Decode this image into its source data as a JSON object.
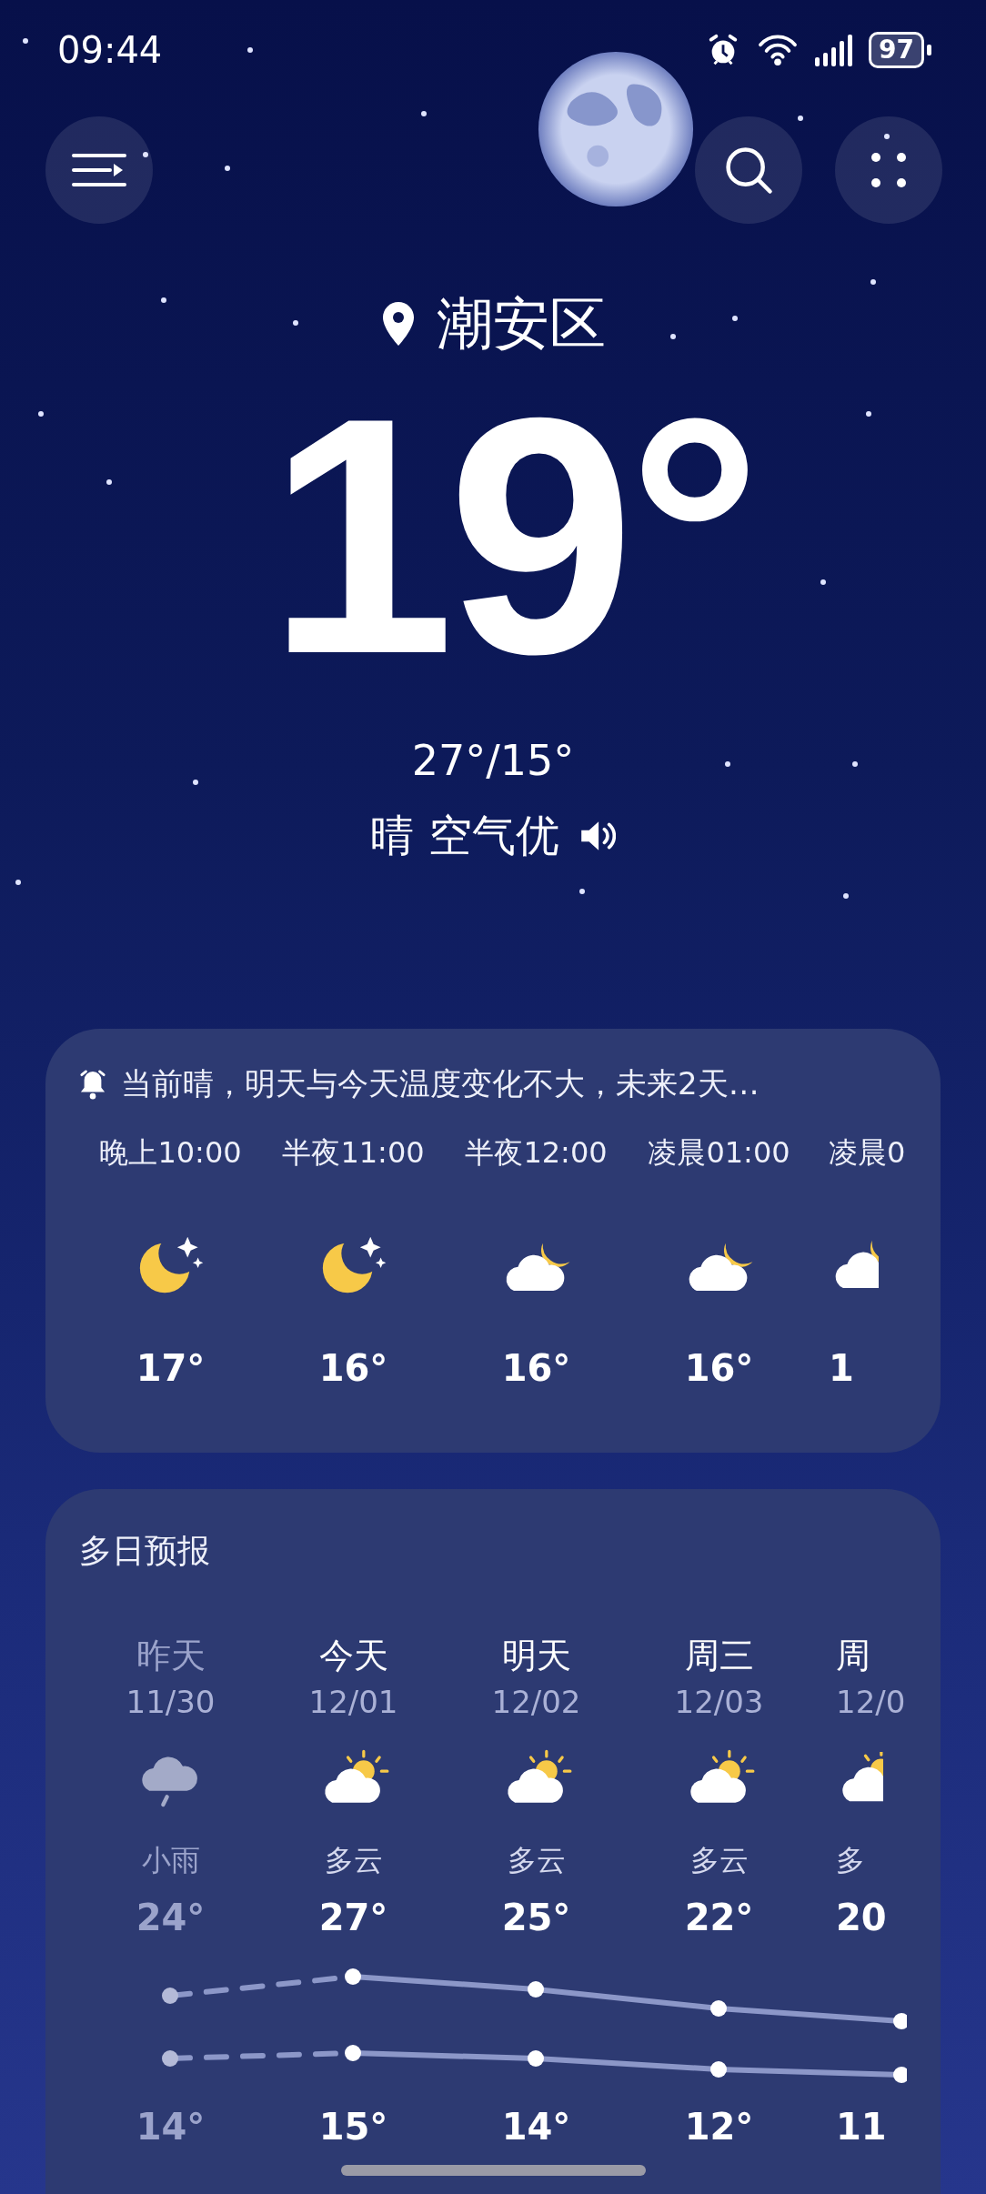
{
  "status_bar": {
    "time": "09:44",
    "battery": "97"
  },
  "location": {
    "name": "潮安区"
  },
  "current": {
    "temperature": "19°",
    "range": "27°/15°",
    "condition": "晴 空气优"
  },
  "hourly": {
    "summary": "当前晴，明天与今天温度变化不大，未来2天…",
    "hours": [
      {
        "time": "晚上10:00",
        "kind": "moon_stars",
        "temp": "17°",
        "cut": false
      },
      {
        "time": "半夜11:00",
        "kind": "moon_stars",
        "temp": "16°",
        "cut": false
      },
      {
        "time": "半夜12:00",
        "kind": "cloud_moon",
        "temp": "16°",
        "cut": false
      },
      {
        "time": "凌晨01:00",
        "kind": "cloud_moon",
        "temp": "16°",
        "cut": false
      },
      {
        "time": "凌晨0",
        "kind": "cloud_moon",
        "temp": "1",
        "cut": true
      }
    ]
  },
  "daily": {
    "title": "多日预报",
    "days": [
      {
        "day": "昨天",
        "date": "11/30",
        "kind": "rain",
        "condition": "小雨",
        "high": "24°",
        "low": "14°",
        "past": true,
        "cut": false
      },
      {
        "day": "今天",
        "date": "12/01",
        "kind": "partly_cloudy",
        "condition": "多云",
        "high": "27°",
        "low": "15°",
        "past": false,
        "cut": false
      },
      {
        "day": "明天",
        "date": "12/02",
        "kind": "partly_cloudy",
        "condition": "多云",
        "high": "25°",
        "low": "14°",
        "past": false,
        "cut": false
      },
      {
        "day": "周三",
        "date": "12/03",
        "kind": "partly_cloudy",
        "condition": "多云",
        "high": "22°",
        "low": "12°",
        "past": false,
        "cut": false
      },
      {
        "day": "周",
        "date": "12/0",
        "kind": "partly_cloudy",
        "condition": "多",
        "high": "20",
        "low": "11",
        "past": false,
        "cut": true
      }
    ]
  }
}
